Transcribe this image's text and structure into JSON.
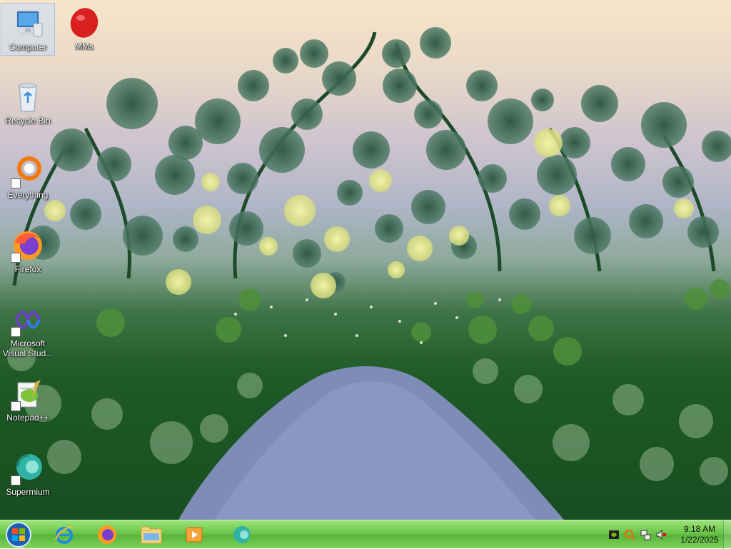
{
  "desktop_icons": [
    {
      "label": "Computer",
      "icon": "computer-icon",
      "selected": true
    },
    {
      "label": "MMs",
      "icon": "mms-icon",
      "selected": false
    },
    {
      "label": "Recycle Bin",
      "icon": "recycle-bin-icon",
      "selected": false
    },
    {
      "label": "Everything",
      "icon": "everything-icon",
      "selected": false
    },
    {
      "label": "Firefox",
      "icon": "firefox-icon",
      "selected": false
    },
    {
      "label": "Microsoft Visual Stud...",
      "icon": "visual-studio-icon",
      "selected": false
    },
    {
      "label": "Notepad++",
      "icon": "notepadpp-icon",
      "selected": false
    },
    {
      "label": "Supermium",
      "icon": "supermium-icon",
      "selected": false
    }
  ],
  "taskbar": {
    "start_icon": "windows-start-icon",
    "pinned": [
      "internet-explorer-icon",
      "firefox-icon",
      "file-explorer-icon",
      "media-player-icon",
      "supermium-icon"
    ]
  },
  "tray": {
    "icons": [
      "nvidia-icon",
      "search-everything-icon",
      "network-icon",
      "volume-muted-icon"
    ],
    "time": "9:18 AM",
    "date": "1/22/2025"
  },
  "colors": {
    "taskbar": "#6cc64a",
    "accent": "#1f5a27"
  }
}
